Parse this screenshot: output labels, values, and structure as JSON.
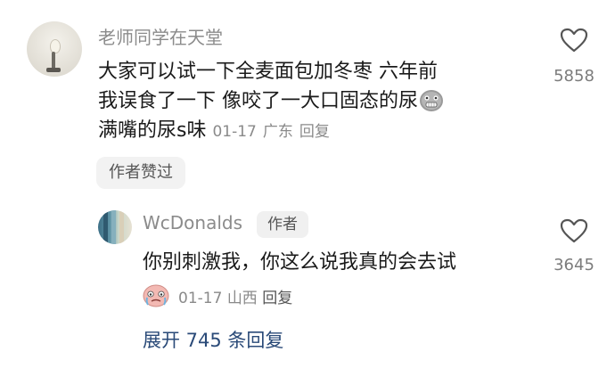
{
  "comment": {
    "username": "老师同学在天堂",
    "lines": [
      "大家可以试一下全麦面包加冬枣 六年前",
      "我误食了一下 像咬了一大口固态的尿",
      "满嘴的尿s味"
    ],
    "date": "01-17",
    "location": "广东",
    "reply_label": "回复",
    "like_count": "5858",
    "author_liked_badge": "作者赞过"
  },
  "reply": {
    "username": "WcDonalds",
    "author_tag": "作者",
    "text": "你别刺激我，你这么说我真的会去试",
    "date": "01-17",
    "location": "山西",
    "reply_label": "回复",
    "like_count": "3645"
  },
  "expand_replies": "展开 745 条回复",
  "icons": {
    "like": "heart-outline-icon",
    "emoji_comment": "grimace-face-icon",
    "emoji_reply": "crying-face-icon"
  },
  "colors": {
    "link": "#2a4a78",
    "muted": "#8b8b8b"
  }
}
